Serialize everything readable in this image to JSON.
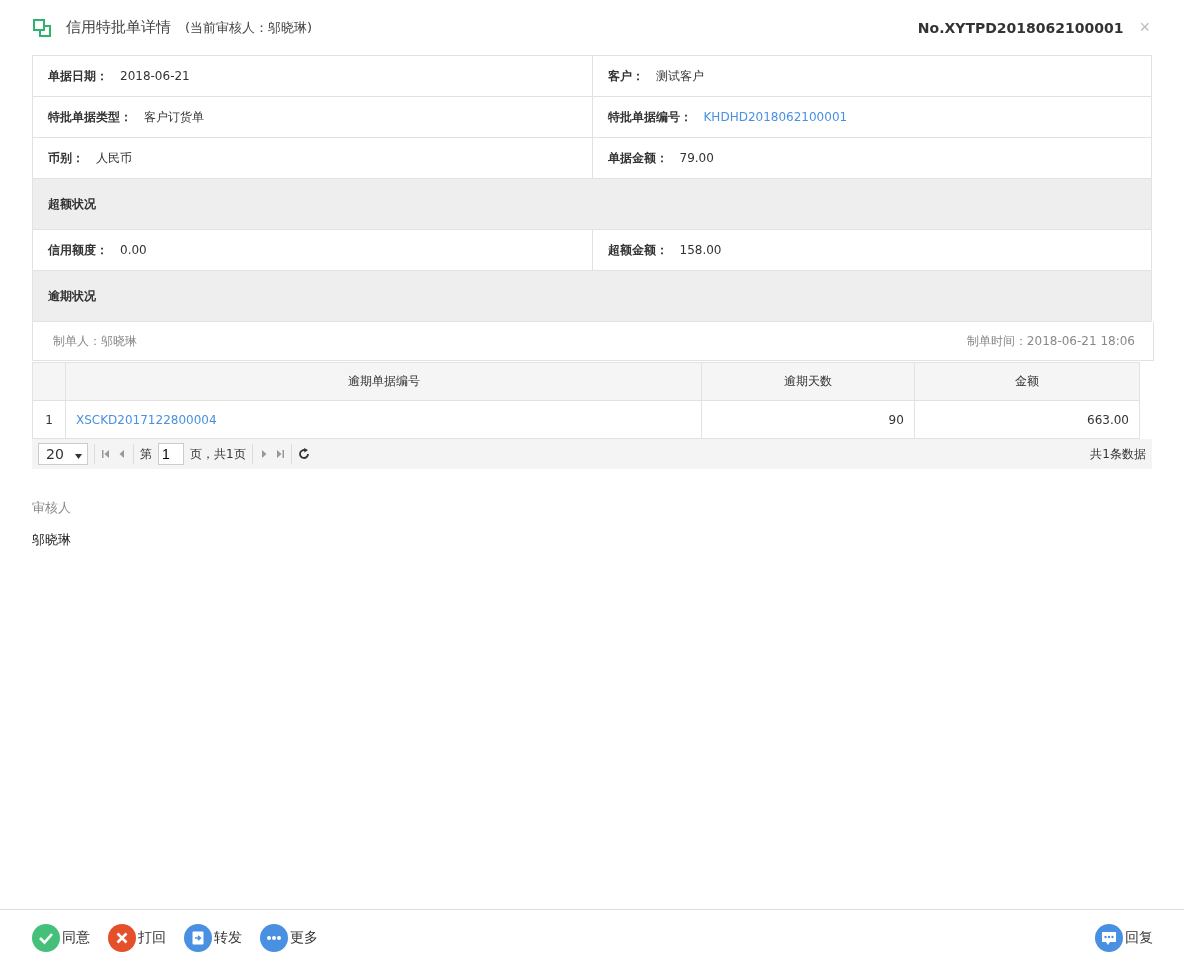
{
  "header": {
    "title": "信用特批单详情",
    "reviewer_note": "(当前审核人：邬晓琳)",
    "number": "No.XYTPD2018062100001",
    "close": "×"
  },
  "info_rows": [
    {
      "kind": "pair",
      "cells": [
        {
          "label": "单据日期：",
          "value": "2018-06-21",
          "link": false
        },
        {
          "label": "客户：",
          "value": "测试客户",
          "link": false
        }
      ]
    },
    {
      "kind": "pair",
      "cells": [
        {
          "label": "特批单据类型：",
          "value": "客户订货单",
          "link": false
        },
        {
          "label": "特批单据编号：",
          "value": "KHDHD2018062100001",
          "link": true
        }
      ]
    },
    {
      "kind": "pair",
      "cells": [
        {
          "label": "币别：",
          "value": "人民币",
          "link": false
        },
        {
          "label": "单据金额：",
          "value": "79.00",
          "link": false
        }
      ]
    },
    {
      "kind": "section",
      "title": "超额状况"
    },
    {
      "kind": "pair",
      "cells": [
        {
          "label": "信用额度：",
          "value": "0.00",
          "link": false
        },
        {
          "label": "超额金额：",
          "value": "158.00",
          "link": false
        }
      ]
    },
    {
      "kind": "section",
      "title": "逾期状况"
    }
  ],
  "creator": {
    "maker": "制单人：邬晓琳",
    "time": "制单时间：2018-06-21 18:06"
  },
  "grid": {
    "columns": [
      "逾期单据编号",
      "逾期天数",
      "金额"
    ],
    "rows": [
      {
        "index": "1",
        "cells": [
          "XSCKD2017122800004",
          "90",
          "663.00"
        ]
      }
    ]
  },
  "pager": {
    "page_size": "20",
    "page_prefix": "第",
    "page": "1",
    "page_suffix": "页，共1页",
    "total": "共1条数据"
  },
  "reviewer": {
    "label": "审核人",
    "name": "邬晓琳"
  },
  "actions": [
    {
      "kind": "agree",
      "label": "同意"
    },
    {
      "kind": "reject",
      "label": "打回"
    },
    {
      "kind": "forward",
      "label": "转发"
    },
    {
      "kind": "more",
      "label": "更多"
    }
  ],
  "reply": {
    "kind": "reply",
    "label": "回复"
  }
}
